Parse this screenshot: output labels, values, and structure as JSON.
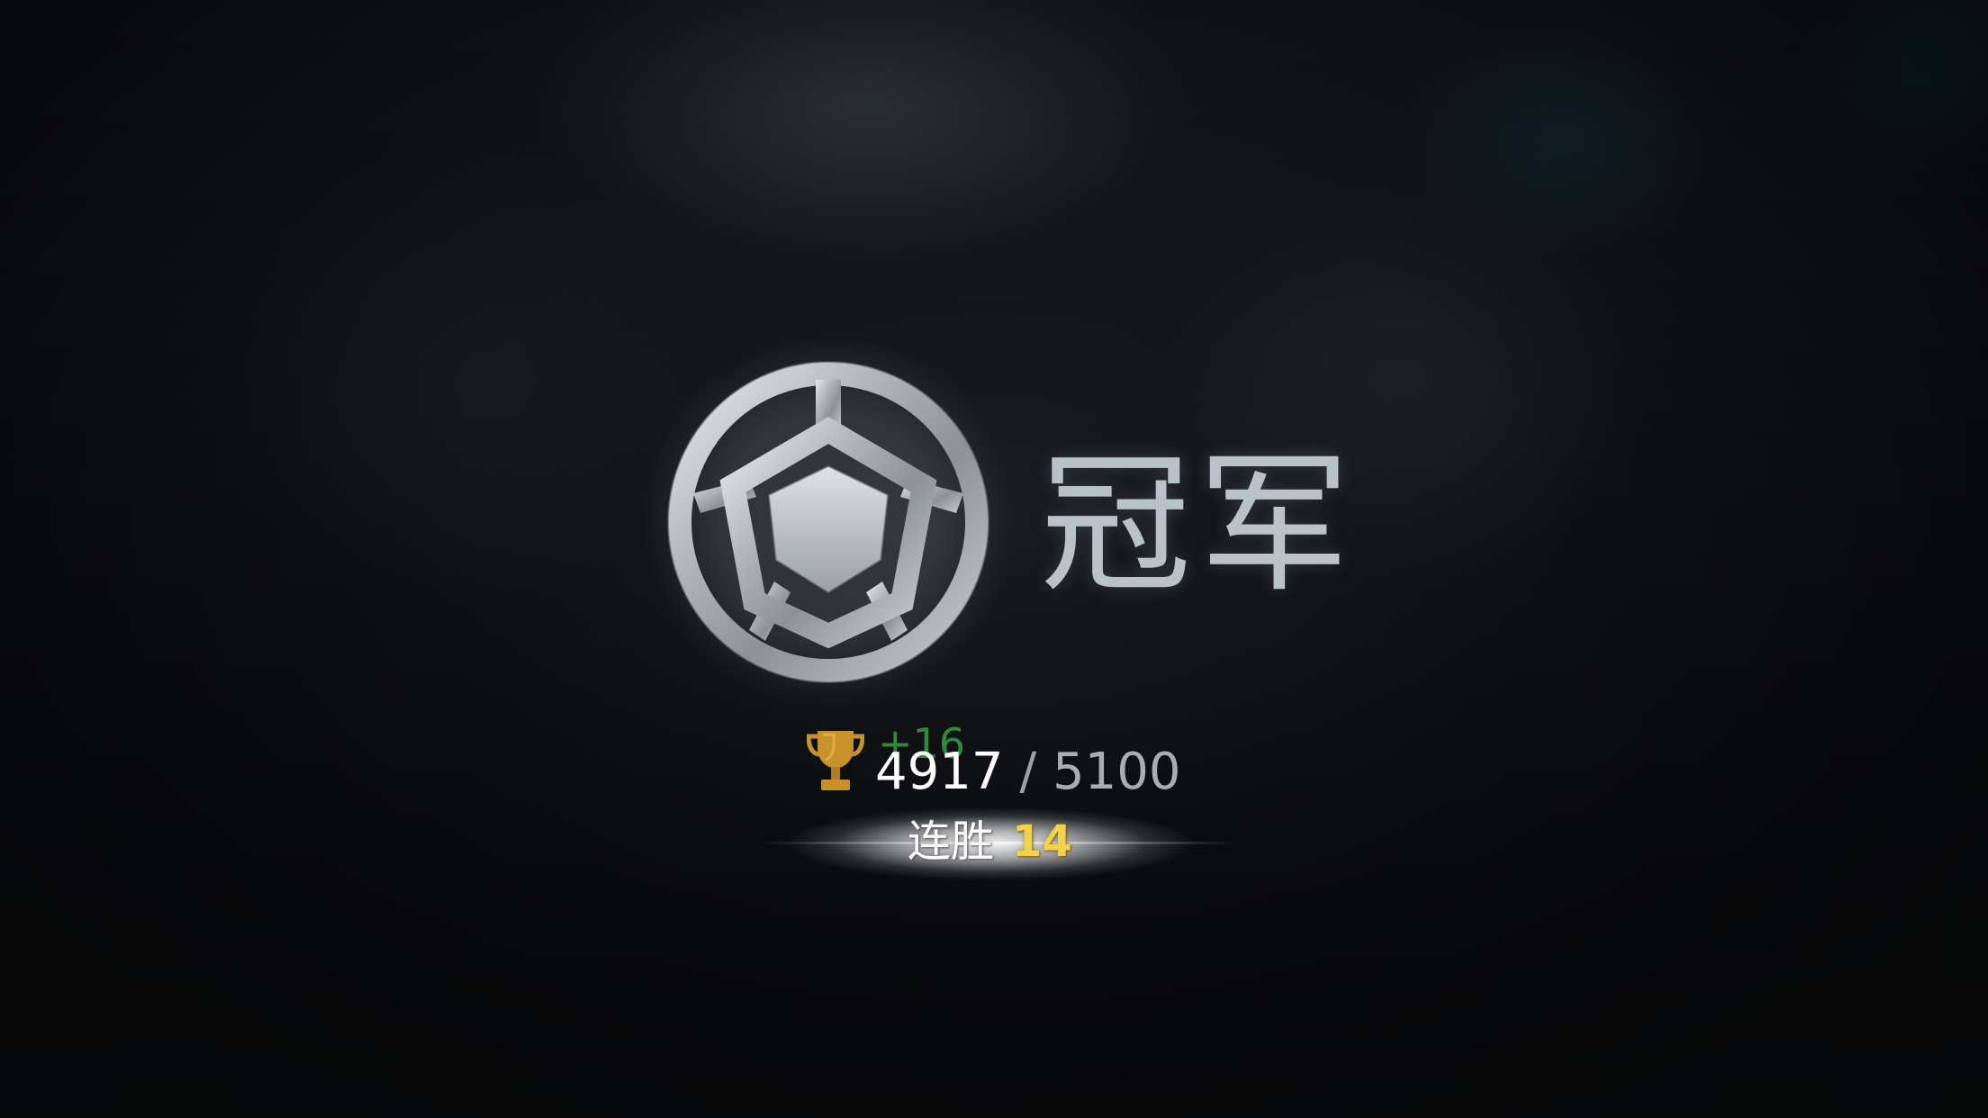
{
  "rank": {
    "title": "冠军",
    "emblem_icon": "champion-rank-emblem-icon"
  },
  "trophies": {
    "icon": "trophy-icon",
    "delta": "+16",
    "current": "4917",
    "separator": " / ",
    "max": "5100"
  },
  "streak": {
    "label": "连胜",
    "value": "14"
  },
  "colors": {
    "rank_title": "#b9c2c8",
    "delta_green": "#2f8a3c",
    "streak_gold": "#f1d24a",
    "trophy_gold": "#c8922a"
  }
}
